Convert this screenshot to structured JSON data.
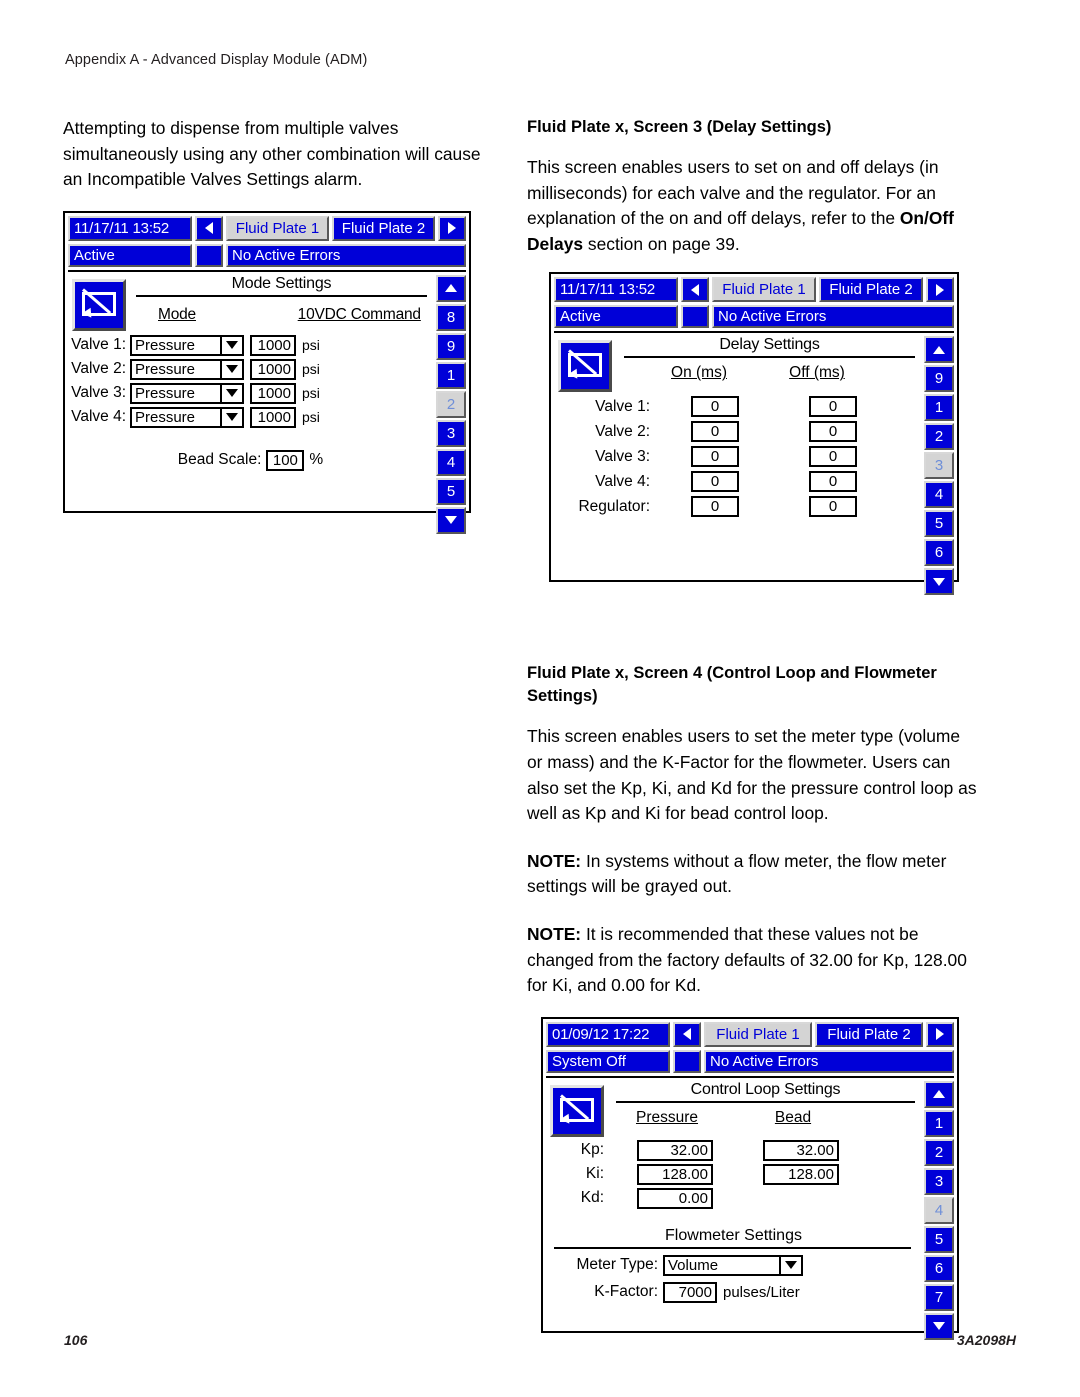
{
  "page": {
    "header": "Appendix A - Advanced Display Module (ADM)",
    "footer_left": "106",
    "footer_right": "3A2098H"
  },
  "left_column": {
    "paragraph": "Attempting to dispense from multiple valves simultaneously using any other combination will cause an Incompatible Valves Settings alarm."
  },
  "right_column": {
    "section3_heading": "Fluid Plate x, Screen 3 (Delay Settings)",
    "section3_body_a": "This screen enables users to set on and off delays (in milliseconds) for each valve and the regulator. For an explanation of the on and off delays, refer to the ",
    "section3_body_bold": "On/Off Delays",
    "section3_body_b": " section on page 39.",
    "section4_heading": "Fluid Plate x, Screen 4 (Control Loop and Flowmeter Settings)",
    "section4_body": "This screen enables users to set the meter type (volume or mass) and the K-Factor for the flowmeter. Users can also set the Kp, Ki, and Kd for the pressure control loop as well as Kp and Ki for bead control loop.",
    "note1_label": "NOTE:",
    "note1_body": " In systems without a flow meter, the flow meter settings will be grayed out.",
    "note2_label": "NOTE:",
    "note2_body": " It is recommended that these values not be changed from the factory defaults of 32.00 for Kp, 128.00 for Ki, and 0.00 for Kd."
  },
  "colors": {
    "screen_blue": "#0000d8",
    "screen_selected_gray": "#d4d4d4",
    "screen_white": "#ffffff"
  },
  "screen_mode": {
    "datetime": "11/17/11 13:52",
    "prev_icon": "arrow-left-icon",
    "next_icon": "arrow-right-icon",
    "tab1": "Fluid Plate 1",
    "tab2": "Fluid Plate 2",
    "status": "Active",
    "errors": "No Active Errors",
    "edit_icon": "edit-screen-icon",
    "title": "Mode Settings",
    "mode_label": "Mode",
    "mode_value": "10VDC Command",
    "valves": [
      {
        "name": "Valve 1:",
        "type": "Pressure",
        "setpoint": "1000",
        "unit": "psi"
      },
      {
        "name": "Valve 2:",
        "type": "Pressure",
        "setpoint": "1000",
        "unit": "psi"
      },
      {
        "name": "Valve 3:",
        "type": "Pressure",
        "setpoint": "1000",
        "unit": "psi"
      },
      {
        "name": "Valve 4:",
        "type": "Pressure",
        "setpoint": "1000",
        "unit": "psi"
      }
    ],
    "bead_scale_label": "Bead Scale:",
    "bead_scale_value": "100",
    "bead_scale_unit": "%",
    "keys": [
      "up-arrow",
      "8",
      "9",
      "1",
      "2",
      "3",
      "4",
      "5",
      "down-arrow"
    ],
    "selected_key": "2"
  },
  "screen_delay": {
    "datetime": "11/17/11 13:52",
    "tab1": "Fluid Plate 1",
    "tab2": "Fluid Plate 2",
    "status": "Active",
    "errors": "No Active Errors",
    "title": "Delay Settings",
    "col_on": "On (ms)",
    "col_off": "Off (ms)",
    "rows": [
      {
        "name": "Valve 1:",
        "on": "0",
        "off": "0"
      },
      {
        "name": "Valve 2:",
        "on": "0",
        "off": "0"
      },
      {
        "name": "Valve 3:",
        "on": "0",
        "off": "0"
      },
      {
        "name": "Valve 4:",
        "on": "0",
        "off": "0"
      },
      {
        "name": "Regulator:",
        "on": "0",
        "off": "0"
      }
    ],
    "keys": [
      "up-arrow",
      "9",
      "1",
      "2",
      "3",
      "4",
      "5",
      "6",
      "down-arrow"
    ],
    "selected_key": "3"
  },
  "screen_control": {
    "datetime": "01/09/12 17:22",
    "tab1": "Fluid Plate 1",
    "tab2": "Fluid Plate 2",
    "status": "System Off",
    "errors": "No Active Errors",
    "title": "Control Loop Settings",
    "col_pressure": "Pressure",
    "col_bead": "Bead",
    "rows": [
      {
        "name": "Kp:",
        "pressure": "32.00",
        "bead": "32.00"
      },
      {
        "name": "Ki:",
        "pressure": "128.00",
        "bead": "128.00"
      },
      {
        "name": "Kd:",
        "pressure": "0.00",
        "bead": ""
      }
    ],
    "flowmeter_title": "Flowmeter Settings",
    "meter_type_label": "Meter Type:",
    "meter_type_value": "Volume",
    "kfactor_label": "K-Factor:",
    "kfactor_value": "7000",
    "kfactor_unit": "pulses/Liter",
    "keys": [
      "up-arrow",
      "1",
      "2",
      "3",
      "4",
      "5",
      "6",
      "7",
      "down-arrow"
    ],
    "selected_key": "4"
  }
}
